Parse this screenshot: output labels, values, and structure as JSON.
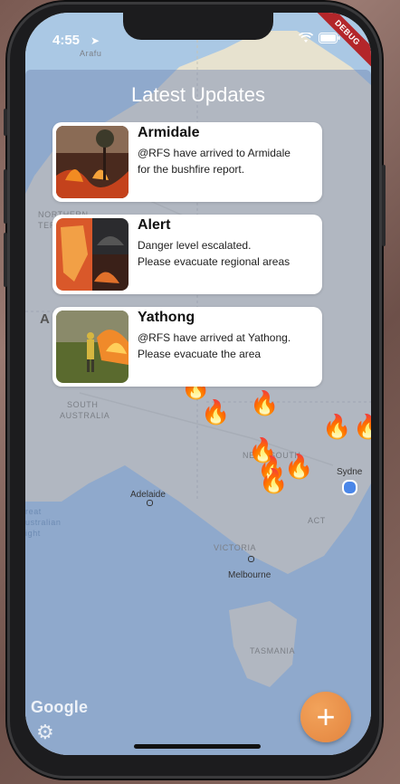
{
  "status": {
    "time": "4:55"
  },
  "debug_banner": "DEBUG",
  "header": {
    "title": "Latest Updates"
  },
  "updates": [
    {
      "title": "Armidale",
      "body": "@RFS have arrived to Armidale\nfor the bushfire report.",
      "thumb": "bushfire-tree-photo"
    },
    {
      "title": "Alert",
      "body": "Danger level escalated.\nPlease evacuate regional areas",
      "thumb": "fire-map-collage-photo"
    },
    {
      "title": "Yathong",
      "body": "@RFS have arrived at Yathong.\nPlease evacuate the area",
      "thumb": "firefighter-photo"
    }
  ],
  "map": {
    "labels": {
      "northern": "NORTHERN",
      "territory": "TERRITORY",
      "south": "SOUTH",
      "australia": "AUSTRALIA",
      "new": "NEW",
      "south_wales": "SOUTH",
      "adelaide": "Adelaide",
      "great": "reat",
      "australian": "ustralian",
      "bight": "ight",
      "act": "ACT",
      "victoria": "VICTORIA",
      "melbourne": "Melbourne",
      "tasmania": "TASMANIA",
      "sydney": "Sydne",
      "a": "A",
      "arafura": "Arafu"
    },
    "brand": "Google"
  },
  "fab": {
    "label": "+"
  },
  "colors": {
    "accent": "#e3843e",
    "debug": "#b3262a",
    "overlay": "#6e82af"
  }
}
